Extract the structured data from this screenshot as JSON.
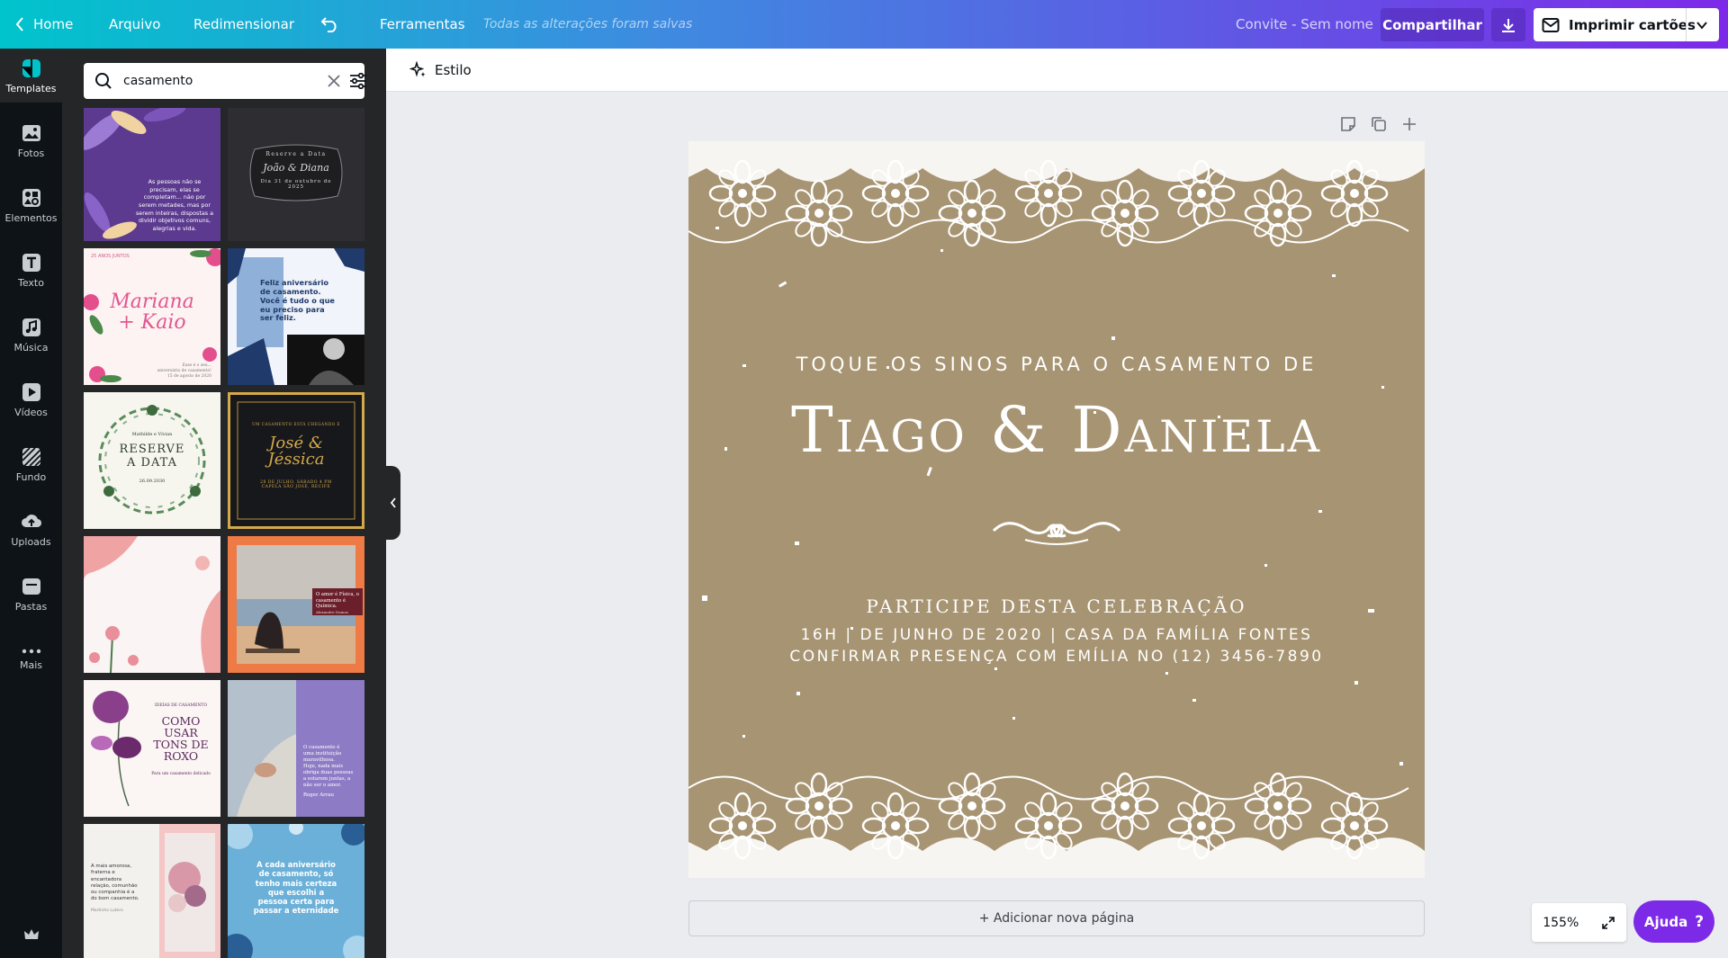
{
  "topbar": {
    "home_label": "Home",
    "file_label": "Arquivo",
    "resize_label": "Redimensionar",
    "tools_label": "Ferramentas",
    "saved_status": "Todas as alterações foram salvas",
    "design_name": "Convite - Sem nome",
    "share_label": "Compartilhar",
    "print_label": "Imprimir cartões"
  },
  "rail": {
    "items": [
      {
        "label": "Templates",
        "icon": "templates-icon"
      },
      {
        "label": "Fotos",
        "icon": "photos-icon"
      },
      {
        "label": "Elementos",
        "icon": "elements-icon"
      },
      {
        "label": "Texto",
        "icon": "text-icon"
      },
      {
        "label": "Música",
        "icon": "music-icon"
      },
      {
        "label": "Vídeos",
        "icon": "video-icon"
      },
      {
        "label": "Fundo",
        "icon": "background-icon"
      },
      {
        "label": "Uploads",
        "icon": "upload-icon"
      },
      {
        "label": "Pastas",
        "icon": "folder-icon"
      },
      {
        "label": "Mais",
        "icon": "more-icon"
      }
    ]
  },
  "search": {
    "value": "casamento",
    "placeholder": "casamento"
  },
  "templates": [
    {
      "lines": [
        "As pessoas não se",
        "precisam, elas se",
        "completam... não por",
        "serem metades, mas por",
        "serem inteiras, dispostas a",
        "dividir objetivos comuns,",
        "alegrias e vida."
      ]
    },
    {
      "lines": [
        "Reserve a Data",
        "João & Diana",
        "Dia 31 de outubro de",
        "2025"
      ]
    },
    {
      "lines": [
        "25 ANOS JUNTOS",
        "Mariana",
        "+ Kaio",
        "Esse é o seu...",
        "aniversário de casamento!",
        "15 de agosto de 2020"
      ]
    },
    {
      "lines": [
        "Feliz aniversário",
        "de casamento.",
        "Você é tudo o que",
        "eu preciso para",
        "ser feliz."
      ]
    },
    {
      "lines": [
        "Mathilde e Vívian",
        "RESERVE",
        "A DATA",
        "26.09.2030"
      ]
    },
    {
      "lines": [
        "UM CASAMENTO ESTÁ CHEGANDO E",
        "José &",
        "Jéssica",
        "28 DE JULHO, SÁBADO 4 PM",
        "CAPELA SÃO JOSÉ, RECIFE"
      ]
    },
    {
      "lines": []
    },
    {
      "lines": [
        "O amor é Física, o",
        "casamento é Química.",
        "Alexandre Dumas"
      ]
    },
    {
      "lines": [
        "IDEIAS DE CASAMENTO",
        "COMO",
        "USAR",
        "TONS DE",
        "ROXO",
        "Para um casamento delicado"
      ]
    },
    {
      "lines": [
        "O casamento é",
        "uma instituição",
        "maravilhosa.",
        "Hoje, nada mais",
        "obriga duas pessoas",
        "a estarem juntas, a",
        "não ser o amor.",
        "Roger Arrau"
      ]
    },
    {
      "lines": [
        "A mais amorosa,",
        "fraterna e",
        "encantadora",
        "relação, comunhão",
        "ou companhia é a",
        "do bom casamento.",
        "Martinho Lutero"
      ]
    },
    {
      "lines": [
        "A cada aniversário",
        "de casamento, só",
        "tenho mais certeza",
        "que escolhi a",
        "pessoa certa para",
        "passar a eternidade"
      ]
    }
  ],
  "toolbar": {
    "style_label": "Estilo"
  },
  "canvas": {
    "line1": "TOQUE OS SINOS PARA O CASAMENTO DE",
    "names": "Tiago & Daniela",
    "line3": "PARTICIPE DESTA CELEBRAÇÃO",
    "line4": "16H | DE JUNHO DE 2020 | CASA DA FAMÍLIA FONTES",
    "line5": "CONFIRMAR PRESENÇA COM EMÍLIA NO (12) 3456-7890",
    "background_color": "#a79472"
  },
  "add_page_label": "+ Adicionar nova página",
  "zoom_label": "155%",
  "help_label": "Ajuda"
}
